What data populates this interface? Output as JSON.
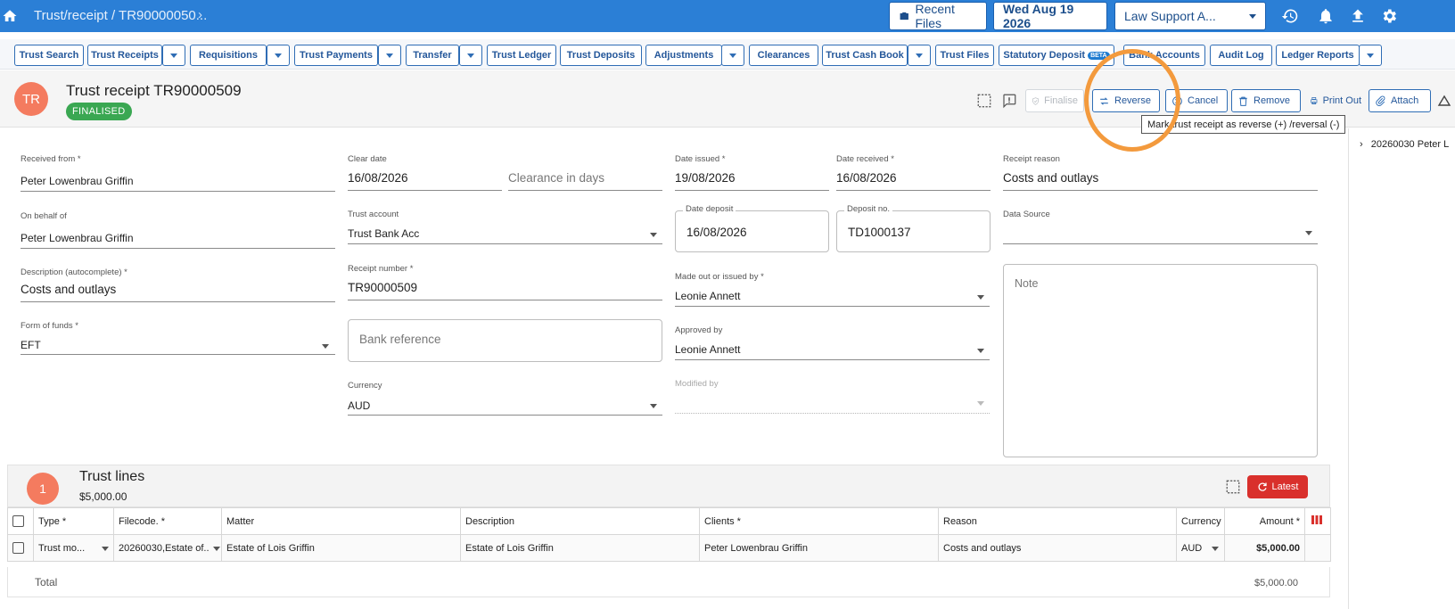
{
  "topbar": {
    "breadcrumb": "Trust/receipt / TR90000050...",
    "recent_files": "Recent Files",
    "date": "Wed Aug 19 2026",
    "account": "Law Support A..."
  },
  "tabs": [
    {
      "label": "Trust Search"
    },
    {
      "label": "Trust Receipts"
    },
    {
      "label": "Requisitions"
    },
    {
      "label": "Trust Payments"
    },
    {
      "label": "Transfer"
    },
    {
      "label": "Trust Ledger"
    },
    {
      "label": "Trust Deposits"
    },
    {
      "label": "Adjustments"
    },
    {
      "label": "Clearances"
    },
    {
      "label": "Trust Cash Book"
    },
    {
      "label": "Trust Files"
    },
    {
      "label": "Statutory Deposit",
      "badge": "BETA"
    },
    {
      "label": "Bank Accounts"
    },
    {
      "label": "Audit Log"
    },
    {
      "label": "Ledger Reports"
    }
  ],
  "header": {
    "avatar": "TR",
    "title": "Trust receipt TR90000509",
    "status": "FINALISED",
    "actions": {
      "finalise": "Finalise",
      "reverse": "Reverse",
      "cancel": "Cancel",
      "remove": "Remove",
      "print": "Print Out",
      "attach": "Attach"
    },
    "tooltip": "Mark trust receipt as reverse (+) /reversal (-)"
  },
  "right_panel": {
    "item": "20260030 Peter L"
  },
  "form": {
    "received_from": {
      "label": "Received from *",
      "value": "Peter Lowenbrau Griffin"
    },
    "on_behalf_of": {
      "label": "On behalf of",
      "value": "Peter Lowenbrau Griffin"
    },
    "description": {
      "label": "Description (autocomplete) *",
      "value": "Costs and outlays"
    },
    "form_of_funds": {
      "label": "Form of funds *",
      "value": "EFT"
    },
    "clear_date": {
      "label": "Clear date",
      "value": "16/08/2026"
    },
    "clearance_days": {
      "placeholder": "Clearance in days"
    },
    "trust_account": {
      "label": "Trust account",
      "value": "Trust Bank Acc"
    },
    "receipt_number": {
      "label": "Receipt number *",
      "value": "TR90000509"
    },
    "bank_reference": {
      "placeholder": "Bank reference"
    },
    "currency": {
      "label": "Currency",
      "value": "AUD"
    },
    "date_issued": {
      "label": "Date issued *",
      "value": "19/08/2026"
    },
    "date_received": {
      "label": "Date received *",
      "value": "16/08/2026"
    },
    "date_deposit": {
      "label": "Date deposit",
      "value": "16/08/2026"
    },
    "deposit_no": {
      "label": "Deposit no.",
      "value": "TD1000137"
    },
    "made_out_by": {
      "label": "Made out or issued by *",
      "value": "Leonie Annett"
    },
    "approved_by": {
      "label": "Approved by",
      "value": "Leonie Annett"
    },
    "modified_by": {
      "label": "Modified by",
      "value": ""
    },
    "receipt_reason": {
      "label": "Receipt reason",
      "value": "Costs and outlays"
    },
    "data_source": {
      "label": "Data Source",
      "value": ""
    },
    "note": {
      "placeholder": "Note"
    }
  },
  "trust_lines": {
    "count": "1",
    "title": "Trust lines",
    "amount": "$5,000.00",
    "latest": "Latest",
    "columns": [
      "Type *",
      "Filecode. *",
      "Matter",
      "Description",
      "Clients *",
      "Reason",
      "Currency",
      "Amount *"
    ],
    "rows": [
      {
        "type": "Trust mo...",
        "filecode": "20260030,Estate of...",
        "matter": "Estate of Lois Griffin",
        "description": "Estate of Lois Griffin",
        "clients": "Peter Lowenbrau Griffin",
        "reason": "Costs and outlays",
        "currency": "AUD",
        "amount": "$5,000.00"
      }
    ],
    "total_label": "Total",
    "total_value": "$5,000.00"
  },
  "colors": {
    "topbar": "#2b7fd6",
    "accent": "#2f6db5",
    "finalised": "#3aa752",
    "latest": "#d9302c",
    "avatar": "#f47b5f",
    "highlight": "#f39a3d"
  }
}
